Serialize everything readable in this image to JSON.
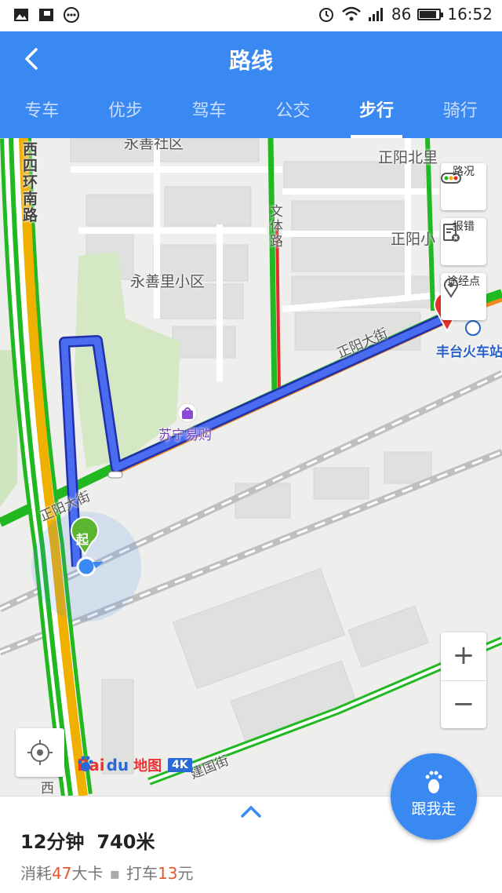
{
  "status_bar": {
    "battery": "86",
    "time": "16:52"
  },
  "header": {
    "title": "路线",
    "back_icon": "chevron-left-icon"
  },
  "tabs": [
    {
      "label": "专车",
      "active": false
    },
    {
      "label": "优步",
      "active": false
    },
    {
      "label": "驾车",
      "active": false
    },
    {
      "label": "公交",
      "active": false
    },
    {
      "label": "步行",
      "active": true
    },
    {
      "label": "骑行",
      "active": false
    }
  ],
  "map": {
    "labels": {
      "yongshan_top": "永善社区",
      "zhengyang_beili": "正阳北里",
      "zhengyang_xiao": "正阳小",
      "xisihuan_nanlu": "西四环南路",
      "wenti_lu": "文体路",
      "yongshanli": "永善里小区",
      "zhengyang_dajie_1": "正阳大街",
      "zhengyang_dajie_2": "正阳大街",
      "suning": "苏宁易购",
      "fengtai_station": "丰台火车站",
      "jianguo_jie": "建国街",
      "xi_bottom": "西",
      "start_marker": "起"
    },
    "side_buttons": [
      {
        "label": "路况",
        "icon": "traffic-light-icon"
      },
      {
        "label": "报错",
        "icon": "report-error-icon"
      },
      {
        "label": "途经点",
        "icon": "waypoint-pin-icon"
      }
    ],
    "zoom": {
      "in": "+",
      "out": "−"
    },
    "logo": {
      "bai": "Bai",
      "du": "du",
      "ditu": "地图",
      "badge": "4K"
    },
    "follow_button": "跟我走",
    "colors": {
      "route": "#3a55e6",
      "traffic_green": "#22b822",
      "traffic_yellow": "#f0b000",
      "traffic_red": "#e22a2a",
      "accent": "#3a88f2"
    }
  },
  "summary": {
    "duration": "12分钟",
    "distance": "740米",
    "calorie_prefix": "消耗",
    "calorie_value": "47",
    "calorie_suffix": "大卡",
    "taxi_prefix": "打车",
    "taxi_value": "13",
    "taxi_suffix": "元"
  }
}
